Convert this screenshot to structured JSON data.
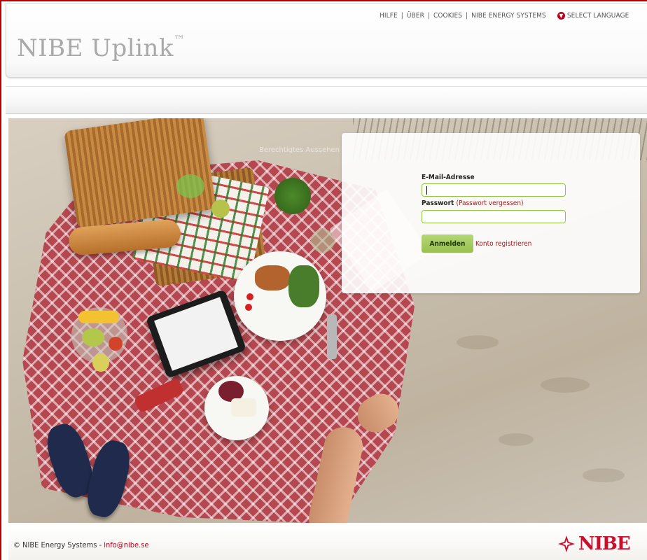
{
  "header": {
    "app_title": "NIBE Uplink",
    "trademark": "™",
    "nav": {
      "help": "HILFE",
      "about": "ÜBER",
      "cookies": "COOKIES",
      "company": "NIBE ENERGY SYSTEMS",
      "language": "SELECT LANGUAGE"
    }
  },
  "hero": {
    "background_hint": "Berechtigtes Aussehen"
  },
  "login": {
    "email_label": "E-Mail-Adresse",
    "email_value": "",
    "password_label": "Passwort",
    "forgot_label": "(Passwort vergessen)",
    "password_value": "",
    "login_button": "Anmelden",
    "register_link": "Konto registrieren"
  },
  "footer": {
    "copyright": "© NIBE Energy Systems",
    "separator": " - ",
    "email": "info@nibe.se",
    "brand": "NIBE"
  },
  "colors": {
    "accent_red": "#c0001a",
    "button_green": "#a8cd62",
    "input_border": "#8ec63f"
  }
}
